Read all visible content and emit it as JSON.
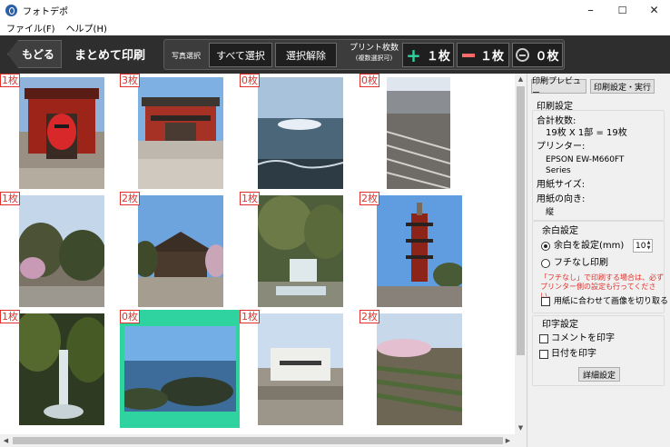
{
  "window": {
    "title": "フォトデポ",
    "minimize": "–",
    "maximize": "☐",
    "close": "✕"
  },
  "menu": [
    "ファイル(F)",
    "ヘルプ(H)"
  ],
  "toolbar": {
    "back_label": "もどる",
    "page_title": "まとめて印刷",
    "photo_select_label": "写真選択",
    "select_all_label": "すべて選択",
    "deselect_label": "選択解除",
    "copies_label": "プリント枚数",
    "copies_sublabel": "(複数選択可)",
    "plus_label": "１枚",
    "minus_label": "１枚",
    "zero_label": "０枚",
    "accent_plus": "#2fd3a0",
    "accent_minus": "#ff6b6b"
  },
  "photos": [
    {
      "count": "1枚",
      "subject": "temple-gate-red-lantern"
    },
    {
      "count": "3枚",
      "subject": "temple-hall"
    },
    {
      "count": "0枚",
      "subject": "sea-sun"
    },
    {
      "count": "0枚",
      "subject": "railway-tracks"
    },
    {
      "count": "1枚",
      "subject": "park-trees"
    },
    {
      "count": "2枚",
      "subject": "temple-roof-sky"
    },
    {
      "count": "1枚",
      "subject": "garden-waterfall"
    },
    {
      "count": "2枚",
      "subject": "pagoda"
    },
    {
      "count": "1枚",
      "subject": "waterfall"
    },
    {
      "count": "0枚",
      "subject": "coast-rocks",
      "selected": true
    },
    {
      "count": "1枚",
      "subject": "stone-monument"
    },
    {
      "count": "2枚",
      "subject": "field-blossoms"
    }
  ],
  "panel": {
    "preview_label": "印刷プレビュー",
    "print_settings_label": "印刷設定・実行",
    "print_settings_title": "印刷設定",
    "total_label": "合計枚数:",
    "total_value": "19枚 X 1部 = 19枚",
    "printer_label": "プリンター:",
    "printer_line1": "EPSON EW-M660FT",
    "printer_line2": "Series",
    "paper_size_label": "用紙サイズ:",
    "orientation_label": "用紙の向き:",
    "orientation_value": "縦",
    "margin_title": "余白設定",
    "margin_on_label": "余白を設定(mm)",
    "margin_value": "10",
    "borderless_label": "フチなし印刷",
    "warning_text": "「フチなし」で印刷する場合は、必ずプリンター側の設定も行ってください。",
    "crop_label": "用紙に合わせて画像を切り取る",
    "imprint_title": "印字設定",
    "comment_label": "コメントを印字",
    "date_label": "日付を印字",
    "detail_label": "詳細設定",
    "warning_color": "#e0322b",
    "selected_color": "#2fd3a0"
  }
}
